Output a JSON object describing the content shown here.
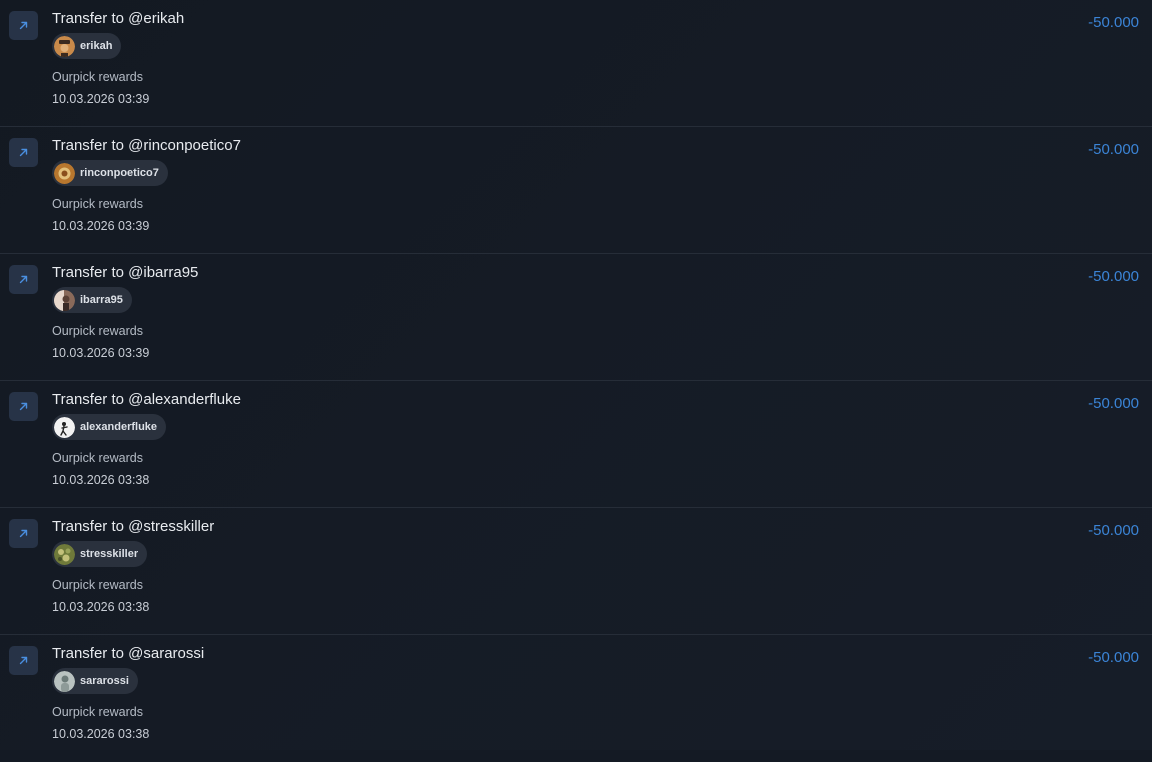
{
  "transactions": [
    {
      "title": "Transfer to @erikah",
      "username": "erikah",
      "reason": "Ourpick rewards",
      "date": "10.03.2026 03:39",
      "amount": "-50.000",
      "avatar_color": "#c98a4a",
      "avatar_accent": "#3a2a20"
    },
    {
      "title": "Transfer to @rinconpoetico7",
      "username": "rinconpoetico7",
      "reason": "Ourpick rewards",
      "date": "10.03.2026 03:39",
      "amount": "-50.000",
      "avatar_color": "#b8772e",
      "avatar_accent": "#e3c07a"
    },
    {
      "title": "Transfer to @ibarra95",
      "username": "ibarra95",
      "reason": "Ourpick rewards",
      "date": "10.03.2026 03:39",
      "amount": "-50.000",
      "avatar_color": "#8a6a5a",
      "avatar_accent": "#e8d8cc"
    },
    {
      "title": "Transfer to @alexanderfluke",
      "username": "alexanderfluke",
      "reason": "Ourpick rewards",
      "date": "10.03.2026 03:38",
      "amount": "-50.000",
      "avatar_color": "#f2f2f2",
      "avatar_accent": "#222222"
    },
    {
      "title": "Transfer to @stresskiller",
      "username": "stresskiller",
      "reason": "Ourpick rewards",
      "date": "10.03.2026 03:38",
      "amount": "-50.000",
      "avatar_color": "#6f7a3a",
      "avatar_accent": "#c3c07a"
    },
    {
      "title": "Transfer to @sararossi",
      "username": "sararossi",
      "reason": "Ourpick rewards",
      "date": "10.03.2026 03:38",
      "amount": "-50.000",
      "avatar_color": "#b9c2c0",
      "avatar_accent": "#6c7a78"
    }
  ],
  "colors": {
    "background": "#141a24",
    "icon_bg": "#273347",
    "icon_arrow": "#4a8fe0",
    "amount": "#3b84d6",
    "divider": "#262d38"
  },
  "icons": {
    "transfer": "arrow-up-right-icon"
  }
}
